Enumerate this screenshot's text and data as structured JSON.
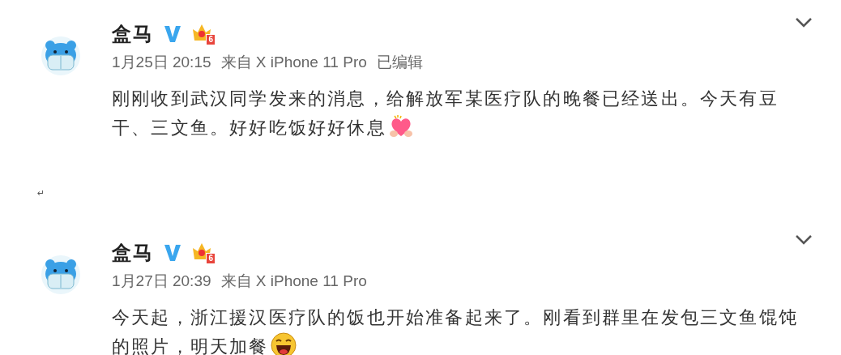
{
  "posts": [
    {
      "author": "盒马",
      "verified": true,
      "level": "6",
      "time": "1月25日 20:15",
      "source": "来自 X iPhone 11 Pro",
      "edited_label": "已编辑",
      "text_lines": [
        "刚刚收到武汉同学发来的消息，给解放军某医疗队的晚餐已经送出。今天有豆",
        "干、三文鱼。好好吃饭好好休息"
      ],
      "emoji": {
        "kind": "heart"
      }
    },
    {
      "author": "盒马",
      "verified": true,
      "level": "6",
      "time": "1月27日 20:39",
      "source": "来自 X iPhone 11 Pro",
      "text_lines": [
        "今天起，浙江援汉医疗队的饭也开始准备起来了。刚看到群里在发包三文鱼馄饨",
        "的照片，明天加餐"
      ],
      "emoji": {
        "kind": "laugh"
      }
    }
  ],
  "paragraph_mark": "↵"
}
